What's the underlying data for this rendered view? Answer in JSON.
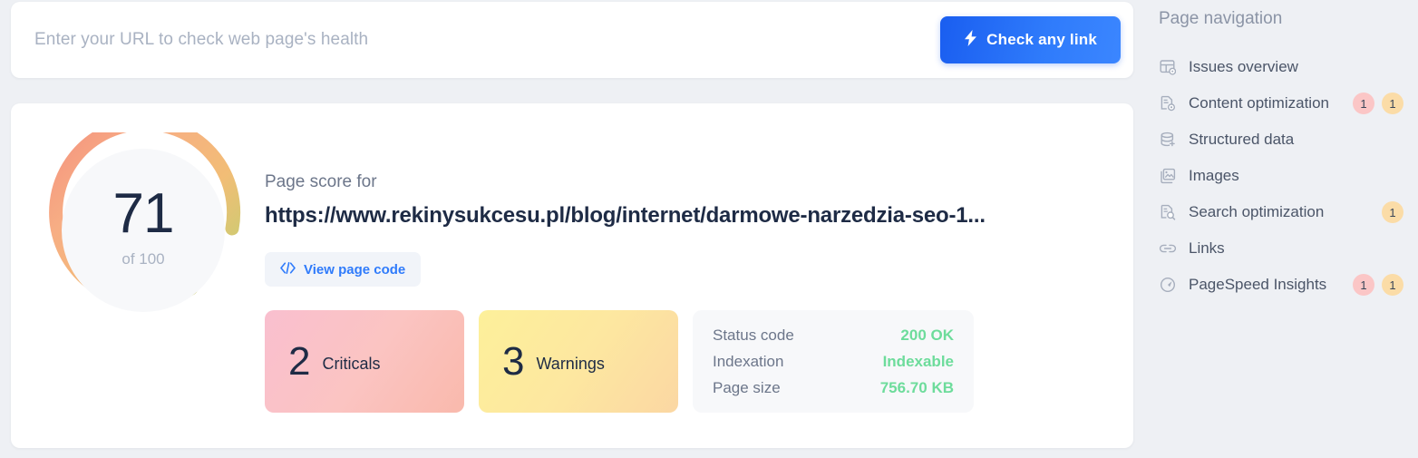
{
  "search": {
    "placeholder": "Enter your URL to check web page's health",
    "value": "",
    "button_label": "Check any link",
    "button_icon": "bolt-icon",
    "button_gradient_from": "#1a5ef0",
    "button_gradient_to": "#3b86ff"
  },
  "report": {
    "score": "71",
    "score_of": "of 100",
    "score_label": "Page score for",
    "url": "https://www.rekinysukcesu.pl/blog/internet/darmowe-narzedzia-seo-1...",
    "view_code_label": "View page code",
    "view_code_icon": "code-icon",
    "donut": {
      "value": 71,
      "max": 100,
      "gradient_start": "#b8d36f",
      "gradient_mid": "#f6c071",
      "gradient_end": "#f4917e",
      "track": "#ffffff",
      "inner_fill": "#f7f8fa"
    },
    "tiles": [
      {
        "count": "2",
        "label": "Criticals",
        "kind": "critical"
      },
      {
        "count": "3",
        "label": "Warnings",
        "kind": "warning"
      }
    ],
    "facts": [
      {
        "key": "Status code",
        "value": "200 OK"
      },
      {
        "key": "Indexation",
        "value": "Indexable"
      },
      {
        "key": "Page size",
        "value": "756.70 KB"
      }
    ],
    "ok_color": "#6ddc9b"
  },
  "nav": {
    "title": "Page navigation",
    "badge_colors": {
      "critical": "#fbc6c6",
      "warning": "#fbdca7"
    },
    "items": [
      {
        "label": "Issues overview",
        "icon": "layout-eye-icon",
        "badges": []
      },
      {
        "label": "Content optimization",
        "icon": "document-gear-icon",
        "badges": [
          {
            "count": "1",
            "kind": "red"
          },
          {
            "count": "1",
            "kind": "orange"
          }
        ]
      },
      {
        "label": "Structured data",
        "icon": "database-plus-icon",
        "badges": []
      },
      {
        "label": "Images",
        "icon": "image-icon",
        "badges": []
      },
      {
        "label": "Search optimization",
        "icon": "document-search-icon",
        "badges": [
          {
            "count": "1",
            "kind": "orange"
          }
        ]
      },
      {
        "label": "Links",
        "icon": "link-icon",
        "badges": []
      },
      {
        "label": "PageSpeed Insights",
        "icon": "gauge-icon",
        "badges": [
          {
            "count": "1",
            "kind": "red"
          },
          {
            "count": "1",
            "kind": "orange"
          }
        ]
      }
    ]
  }
}
